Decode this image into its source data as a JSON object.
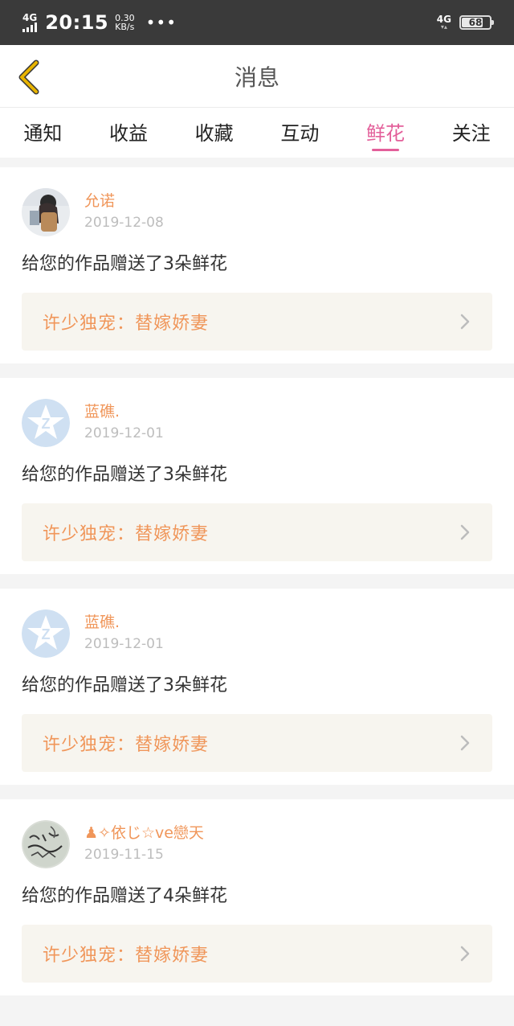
{
  "status_bar": {
    "network": "4G",
    "time": "20:15",
    "speed_value": "0.30",
    "speed_unit": "KB/s",
    "dots": "•••",
    "network_right": "4G",
    "battery": "68"
  },
  "header": {
    "title": "消息"
  },
  "tabs": [
    {
      "label": "通知",
      "active": false
    },
    {
      "label": "收益",
      "active": false
    },
    {
      "label": "收藏",
      "active": false
    },
    {
      "label": "互动",
      "active": false
    },
    {
      "label": "鲜花",
      "active": true
    },
    {
      "label": "关注",
      "active": false
    }
  ],
  "messages": [
    {
      "nickname": "允诺",
      "date": "2019-12-08",
      "text": "给您的作品赠送了3朵鲜花",
      "work_title": "许少独宠：替嫁娇妻",
      "avatar": "photo-girl"
    },
    {
      "nickname": "蓝礁.",
      "date": "2019-12-01",
      "text": "给您的作品赠送了3朵鲜花",
      "work_title": "许少独宠：替嫁娇妻",
      "avatar": "default-star"
    },
    {
      "nickname": "蓝礁.",
      "date": "2019-12-01",
      "text": "给您的作品赠送了3朵鲜花",
      "work_title": "许少独宠：替嫁娇妻",
      "avatar": "default-star"
    },
    {
      "nickname": "♟✧依じ☆ve戀天",
      "date": "2019-11-15",
      "text": "给您的作品赠送了4朵鲜花",
      "work_title": "许少独宠：替嫁娇妻",
      "avatar": "handwriting"
    }
  ],
  "colors": {
    "accent_pink": "#e35f9a",
    "orange_text": "#f0965a",
    "back_arrow": "#e8b400"
  }
}
